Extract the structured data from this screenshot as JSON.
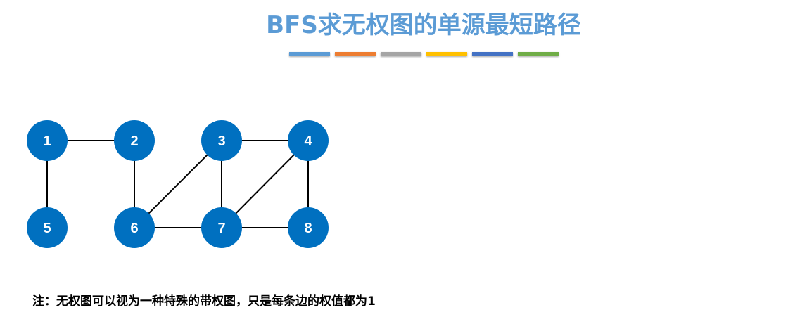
{
  "title": "BFS求无权图的单源最短路径",
  "title_color": "#5b9bd5",
  "decor_bar_colors": [
    "#5b9bd5",
    "#ed7d31",
    "#a5a5a5",
    "#ffc000",
    "#4472c4",
    "#70ad47"
  ],
  "graph": {
    "node_color": "#0070c0",
    "nodes": [
      {
        "id": "1",
        "label": "1"
      },
      {
        "id": "2",
        "label": "2"
      },
      {
        "id": "3",
        "label": "3"
      },
      {
        "id": "4",
        "label": "4"
      },
      {
        "id": "5",
        "label": "5"
      },
      {
        "id": "6",
        "label": "6"
      },
      {
        "id": "7",
        "label": "7"
      },
      {
        "id": "8",
        "label": "8"
      }
    ],
    "edges": [
      [
        "1",
        "2"
      ],
      [
        "1",
        "5"
      ],
      [
        "2",
        "6"
      ],
      [
        "3",
        "4"
      ],
      [
        "3",
        "6"
      ],
      [
        "3",
        "7"
      ],
      [
        "4",
        "7"
      ],
      [
        "4",
        "8"
      ],
      [
        "6",
        "7"
      ],
      [
        "7",
        "8"
      ]
    ]
  },
  "note": "注：无权图可以视为一种特殊的带权图，只是每条边的权值都为1"
}
